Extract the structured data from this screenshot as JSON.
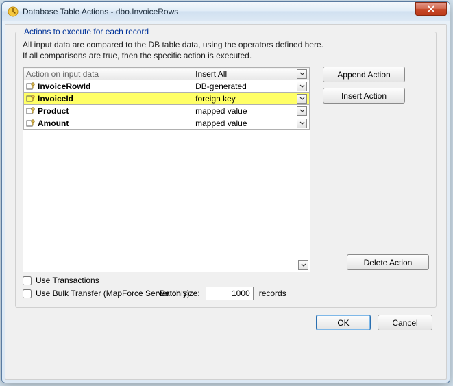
{
  "window": {
    "title": "Database Table Actions - dbo.InvoiceRows"
  },
  "group": {
    "label": "Actions to execute for each record",
    "desc1": "All input data are compared to the DB table data, using the operators defined here.",
    "desc2": "If all comparisons are true, then the specific action is executed."
  },
  "table": {
    "header_left": "Action on input data",
    "header_action": "Insert All",
    "rows": [
      {
        "name": "InvoiceRowId",
        "value": "DB-generated",
        "highlight": false
      },
      {
        "name": "InvoiceId",
        "value": "foreign key",
        "highlight": true
      },
      {
        "name": "Product",
        "value": "mapped value",
        "highlight": false
      },
      {
        "name": "Amount",
        "value": "mapped value",
        "highlight": false
      }
    ]
  },
  "buttons": {
    "append": "Append Action",
    "insert": "Insert Action",
    "delete": "Delete Action",
    "ok": "OK",
    "cancel": "Cancel"
  },
  "options": {
    "use_transactions": "Use Transactions",
    "use_bulk": "Use Bulk Transfer (MapForce Server only)",
    "batch_label": "Batch size:",
    "batch_value": "1000",
    "batch_unit": "records"
  }
}
